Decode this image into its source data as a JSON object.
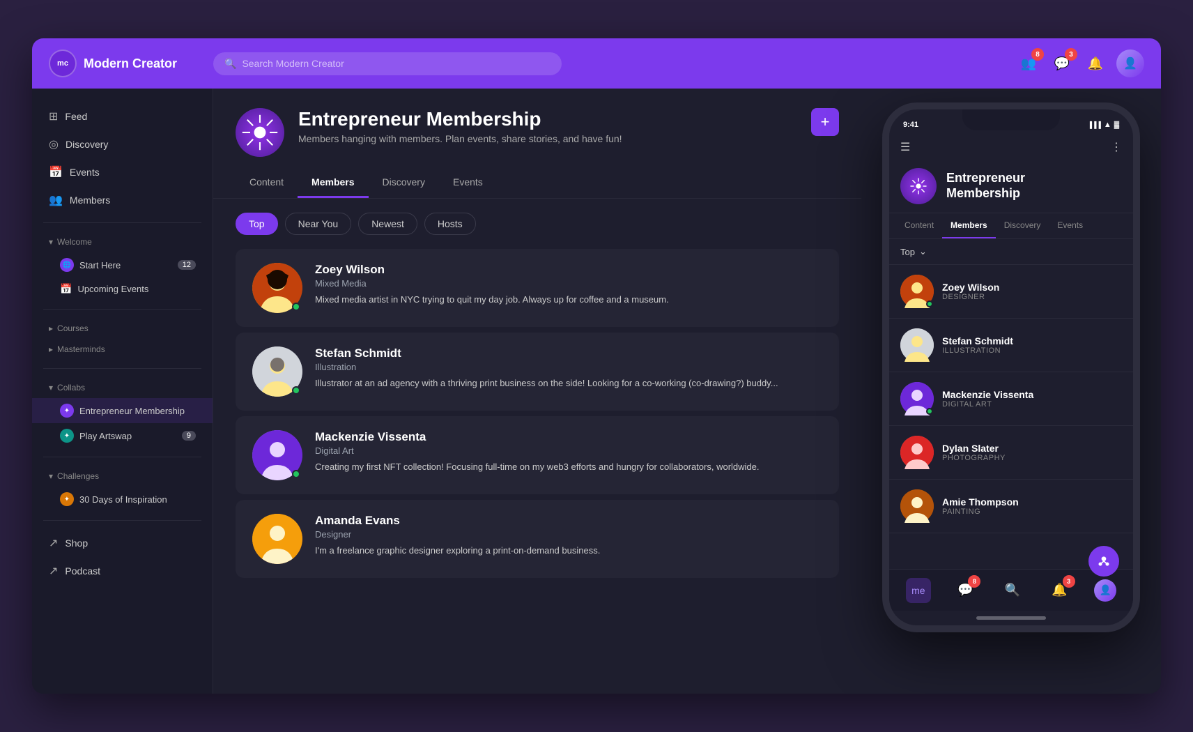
{
  "app": {
    "name": "Modern Creator",
    "logo": "mc",
    "search_placeholder": "Search Modern Creator"
  },
  "nav_badges": {
    "people": "8",
    "bell": "3"
  },
  "sidebar": {
    "items": [
      {
        "label": "Feed",
        "icon": "📋",
        "active": false
      },
      {
        "label": "Discovery",
        "icon": "🧭",
        "active": false
      },
      {
        "label": "Events",
        "icon": "📅",
        "active": false
      },
      {
        "label": "Members",
        "icon": "👥",
        "active": false
      }
    ],
    "sections": [
      {
        "label": "Welcome",
        "items": [
          {
            "label": "Start Here",
            "badge": "12",
            "icon": "🌐"
          },
          {
            "label": "Upcoming Events",
            "icon": "📅"
          }
        ]
      },
      {
        "label": "Courses",
        "items": []
      },
      {
        "label": "Masterminds",
        "items": []
      },
      {
        "label": "Collabs",
        "items": [
          {
            "label": "Entrepreneur Membership",
            "icon": "purple",
            "active": true
          },
          {
            "label": "Play Artswap",
            "icon": "teal",
            "badge": "9"
          }
        ]
      },
      {
        "label": "Challenges",
        "items": [
          {
            "label": "30 Days of Inspiration",
            "icon": "orange"
          }
        ]
      }
    ],
    "footer": [
      {
        "label": "Shop",
        "icon": "🛍️"
      },
      {
        "label": "Podcast",
        "icon": "🎙️"
      }
    ]
  },
  "community": {
    "name": "Entrepreneur Membership",
    "description": "Members hanging with members. Plan events, share stories, and have fun!",
    "tabs": [
      "Content",
      "Members",
      "Discovery",
      "Events"
    ],
    "active_tab": "Members",
    "add_btn": "+",
    "filter_tabs": [
      "Top",
      "Near You",
      "Newest",
      "Hosts"
    ],
    "active_filter": "Top"
  },
  "members": [
    {
      "name": "Zoey Wilson",
      "role": "Mixed Media",
      "bio": "Mixed media artist in NYC trying to quit my day job. Always up for coffee and a museum.",
      "online": true,
      "avatar_color": "#d97706"
    },
    {
      "name": "Stefan Schmidt",
      "role": "Illustration",
      "bio": "Illustrator at an ad agency with a thriving print business on the side! Looking for a co-working (co-drawing?) buddy...",
      "online": true,
      "avatar_color": "#9ca3af"
    },
    {
      "name": "Mackenzie Vissenta",
      "role": "Digital Art",
      "bio": "Creating my first NFT collection! Focusing full-time on my web3 efforts and hungry for collaborators, worldwide.",
      "online": true,
      "avatar_color": "#7c3aed"
    },
    {
      "name": "Amanda Evans",
      "role": "Designer",
      "bio": "I'm a freelance graphic designer exploring a print-on-demand business.",
      "online": false,
      "avatar_color": "#d97706"
    }
  ],
  "phone": {
    "time": "9:41",
    "community_name": "Entrepreneur\nMembership",
    "tabs": [
      "Content",
      "Members",
      "Discovery",
      "Events"
    ],
    "active_tab": "Members",
    "filter": "Top",
    "members": [
      {
        "name": "Zoey Wilson",
        "role": "DESIGNER",
        "online": true,
        "avatar_color": "#d97706"
      },
      {
        "name": "Stefan Schmidt",
        "role": "ILLUSTRATION",
        "online": false,
        "avatar_color": "#9ca3af"
      },
      {
        "name": "Mackenzie Vissenta",
        "role": "DIGITAL ART",
        "online": true,
        "avatar_color": "#7c3aed"
      },
      {
        "name": "Dylan Slater",
        "role": "PHOTOGRAPHY",
        "online": false,
        "avatar_color": "#dc2626"
      },
      {
        "name": "Amie Thompson",
        "role": "PAINTING",
        "online": false,
        "avatar_color": "#b45309"
      }
    ]
  }
}
